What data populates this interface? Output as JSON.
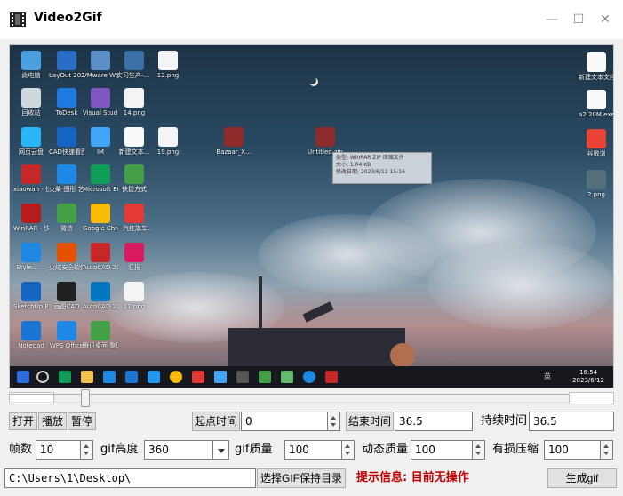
{
  "window": {
    "title": "Video2Gif",
    "minimize_icon": "minimize-icon",
    "maximize_icon": "maximize-icon",
    "close_icon": "close-icon"
  },
  "preview": {
    "desktop_icons": [
      {
        "label": "此电脑",
        "color": "#4a9fe0"
      },
      {
        "label": "LayOut 2022",
        "color": "#2b6cc4"
      },
      {
        "label": "VMware Workstati...",
        "color": "#5d8fc7"
      },
      {
        "label": "实习生产-... 个企...",
        "color": "#3a6fa8"
      },
      {
        "label": "12.png",
        "color": "#f4f4f4"
      },
      {
        "label": "回收站",
        "color": "#cfd8dc"
      },
      {
        "label": "ToDesk",
        "color": "#1f7ae0"
      },
      {
        "label": "Visual Stud...",
        "color": "#7e57c2"
      },
      {
        "label": "14.png",
        "color": "#f4f4f4"
      },
      {
        "label": "网页云盘",
        "color": "#29b6f6"
      },
      {
        "label": "CAD快速看图",
        "color": "#1565c0"
      },
      {
        "label": "IM",
        "color": "#42a5f5"
      },
      {
        "label": "新建文本...",
        "color": "#fafafa"
      },
      {
        "label": "19.png",
        "color": "#f4f4f4"
      },
      {
        "label": "Bazaar_X...",
        "color": "#8d2b2b"
      },
      {
        "label": "Untitled.zip",
        "color": "#8d2b2b"
      },
      {
        "label": "xiaowan - 快捷方式",
        "color": "#c62828"
      },
      {
        "label": "火柴·图形 艺术馆...",
        "color": "#1e88e5"
      },
      {
        "label": "Microsoft Edge",
        "color": "#0f9d58"
      },
      {
        "label": "快捷方式",
        "color": "#43a047"
      },
      {
        "label": "WinRAR - 快捷方式",
        "color": "#b71c1c"
      },
      {
        "label": "微信",
        "color": "#43a047"
      },
      {
        "label": "Google Chrome",
        "color": "#fbbc05"
      },
      {
        "label": "一汽红旗车... .exe",
        "color": "#e53935"
      },
      {
        "label": "Style... ...",
        "color": "#1e88e5"
      },
      {
        "label": "火绒安全软件",
        "color": "#e65100"
      },
      {
        "label": "AutoCAD 2018...",
        "color": "#c62828"
      },
      {
        "label": "汇报",
        "color": "#d81b60"
      },
      {
        "label": "SketchUp Pro 2022",
        "color": "#1565c0"
      },
      {
        "label": "画图CAD",
        "color": "#212121"
      },
      {
        "label": "AutoCAD 2019...",
        "color": "#0277bd"
      },
      {
        "label": "11.png",
        "color": "#f4f4f4"
      },
      {
        "label": "Notepad",
        "color": "#1976d2"
      },
      {
        "label": "WPS Office",
        "color": "#1e88e5"
      },
      {
        "label": "腾讯桌面 整理",
        "color": "#43a047"
      },
      {
        "label": "新建文本文档.txt",
        "color": "#fafafa"
      },
      {
        "label": "a2 20M.exe",
        "color": "#fafafa"
      },
      {
        "label": "谷歌浏",
        "color": "#ea4335"
      },
      {
        "label": "2.png",
        "color": "#546e7a"
      }
    ],
    "tooltip": [
      "类型: WinRAR ZIP 压缩文件",
      "大小: 1.04 KB",
      "修改日期: 2023/6/12 15:16"
    ],
    "taskbar_clock_time": "16:54",
    "taskbar_clock_date": "2023/6/12",
    "taskbar_lang": "英"
  },
  "controls": {
    "open_label": "打开",
    "play_label": "播放",
    "pause_label": "暂停",
    "start_time_label": "起点时间",
    "start_time_value": "0",
    "end_time_label": "结束时间",
    "end_time_value": "36.5",
    "duration_label": "持续时间",
    "duration_value": "36.5",
    "fps_label": "帧数",
    "fps_value": "10",
    "height_label": "gif高度",
    "height_value": "360",
    "quality_label": "gif质量",
    "quality_value": "100",
    "dyn_quality_label": "动态质量",
    "dyn_quality_value": "100",
    "lossy_label": "有损压缩",
    "lossy_value": "100",
    "path_value": "C:\\Users\\1\\Desktop\\",
    "choose_dir_label": "选择GIF保持目录",
    "hint_text": "提示信息: 目前无操作",
    "generate_label": "生成gif",
    "playback_progress": 0.12
  }
}
